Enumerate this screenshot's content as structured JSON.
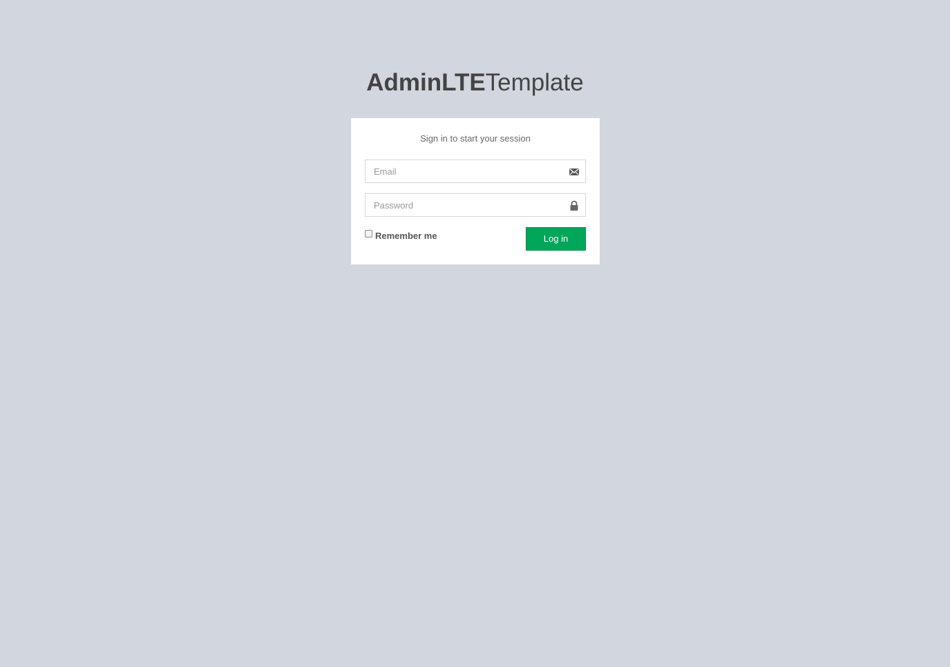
{
  "logo": {
    "bold_text": "AdminLTE",
    "light_text": "Template"
  },
  "login": {
    "message": "Sign in to start your session",
    "email": {
      "placeholder": "Email",
      "value": "",
      "icon": "envelope-icon"
    },
    "password": {
      "placeholder": "Password",
      "value": "",
      "icon": "lock-icon"
    },
    "remember_label": "Remember me",
    "remember_checked": false,
    "submit_label": "Log in"
  },
  "colors": {
    "background": "#d2d6de",
    "box": "#ffffff",
    "button": "#00a65a",
    "text": "#444444"
  }
}
